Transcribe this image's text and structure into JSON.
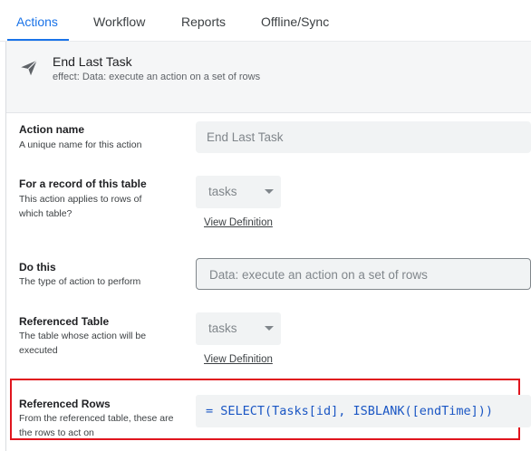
{
  "tabs": [
    {
      "label": "Actions",
      "active": true
    },
    {
      "label": "Workflow"
    },
    {
      "label": "Reports"
    },
    {
      "label": "Offline/Sync"
    }
  ],
  "action": {
    "title": "End Last Task",
    "subtitle_prefix": "effect:",
    "subtitle_value": "Data: execute an action on a set of rows",
    "icon": "send-icon"
  },
  "fields": {
    "action_name": {
      "label": "Action name",
      "description": "A unique name for this action",
      "value": "End Last Task"
    },
    "for_record": {
      "label": "For a record of this table",
      "description": "This action applies to rows of which table?",
      "value": "tasks",
      "link": "View Definition"
    },
    "do_this": {
      "label": "Do this",
      "description": "The type of action to perform",
      "value": "Data: execute an action on a set of rows"
    },
    "referenced_table": {
      "label": "Referenced Table",
      "description": "The table whose action will be executed",
      "value": "tasks",
      "link": "View Definition"
    },
    "referenced_rows": {
      "label": "Referenced Rows",
      "description": "From the referenced table, these are the rows to act on",
      "value": "= SELECT(Tasks[id], ISBLANK([endTime]))"
    }
  },
  "colors": {
    "accent": "#1a73e8",
    "highlight": "#e0151e",
    "formula": "#1a56c4"
  }
}
